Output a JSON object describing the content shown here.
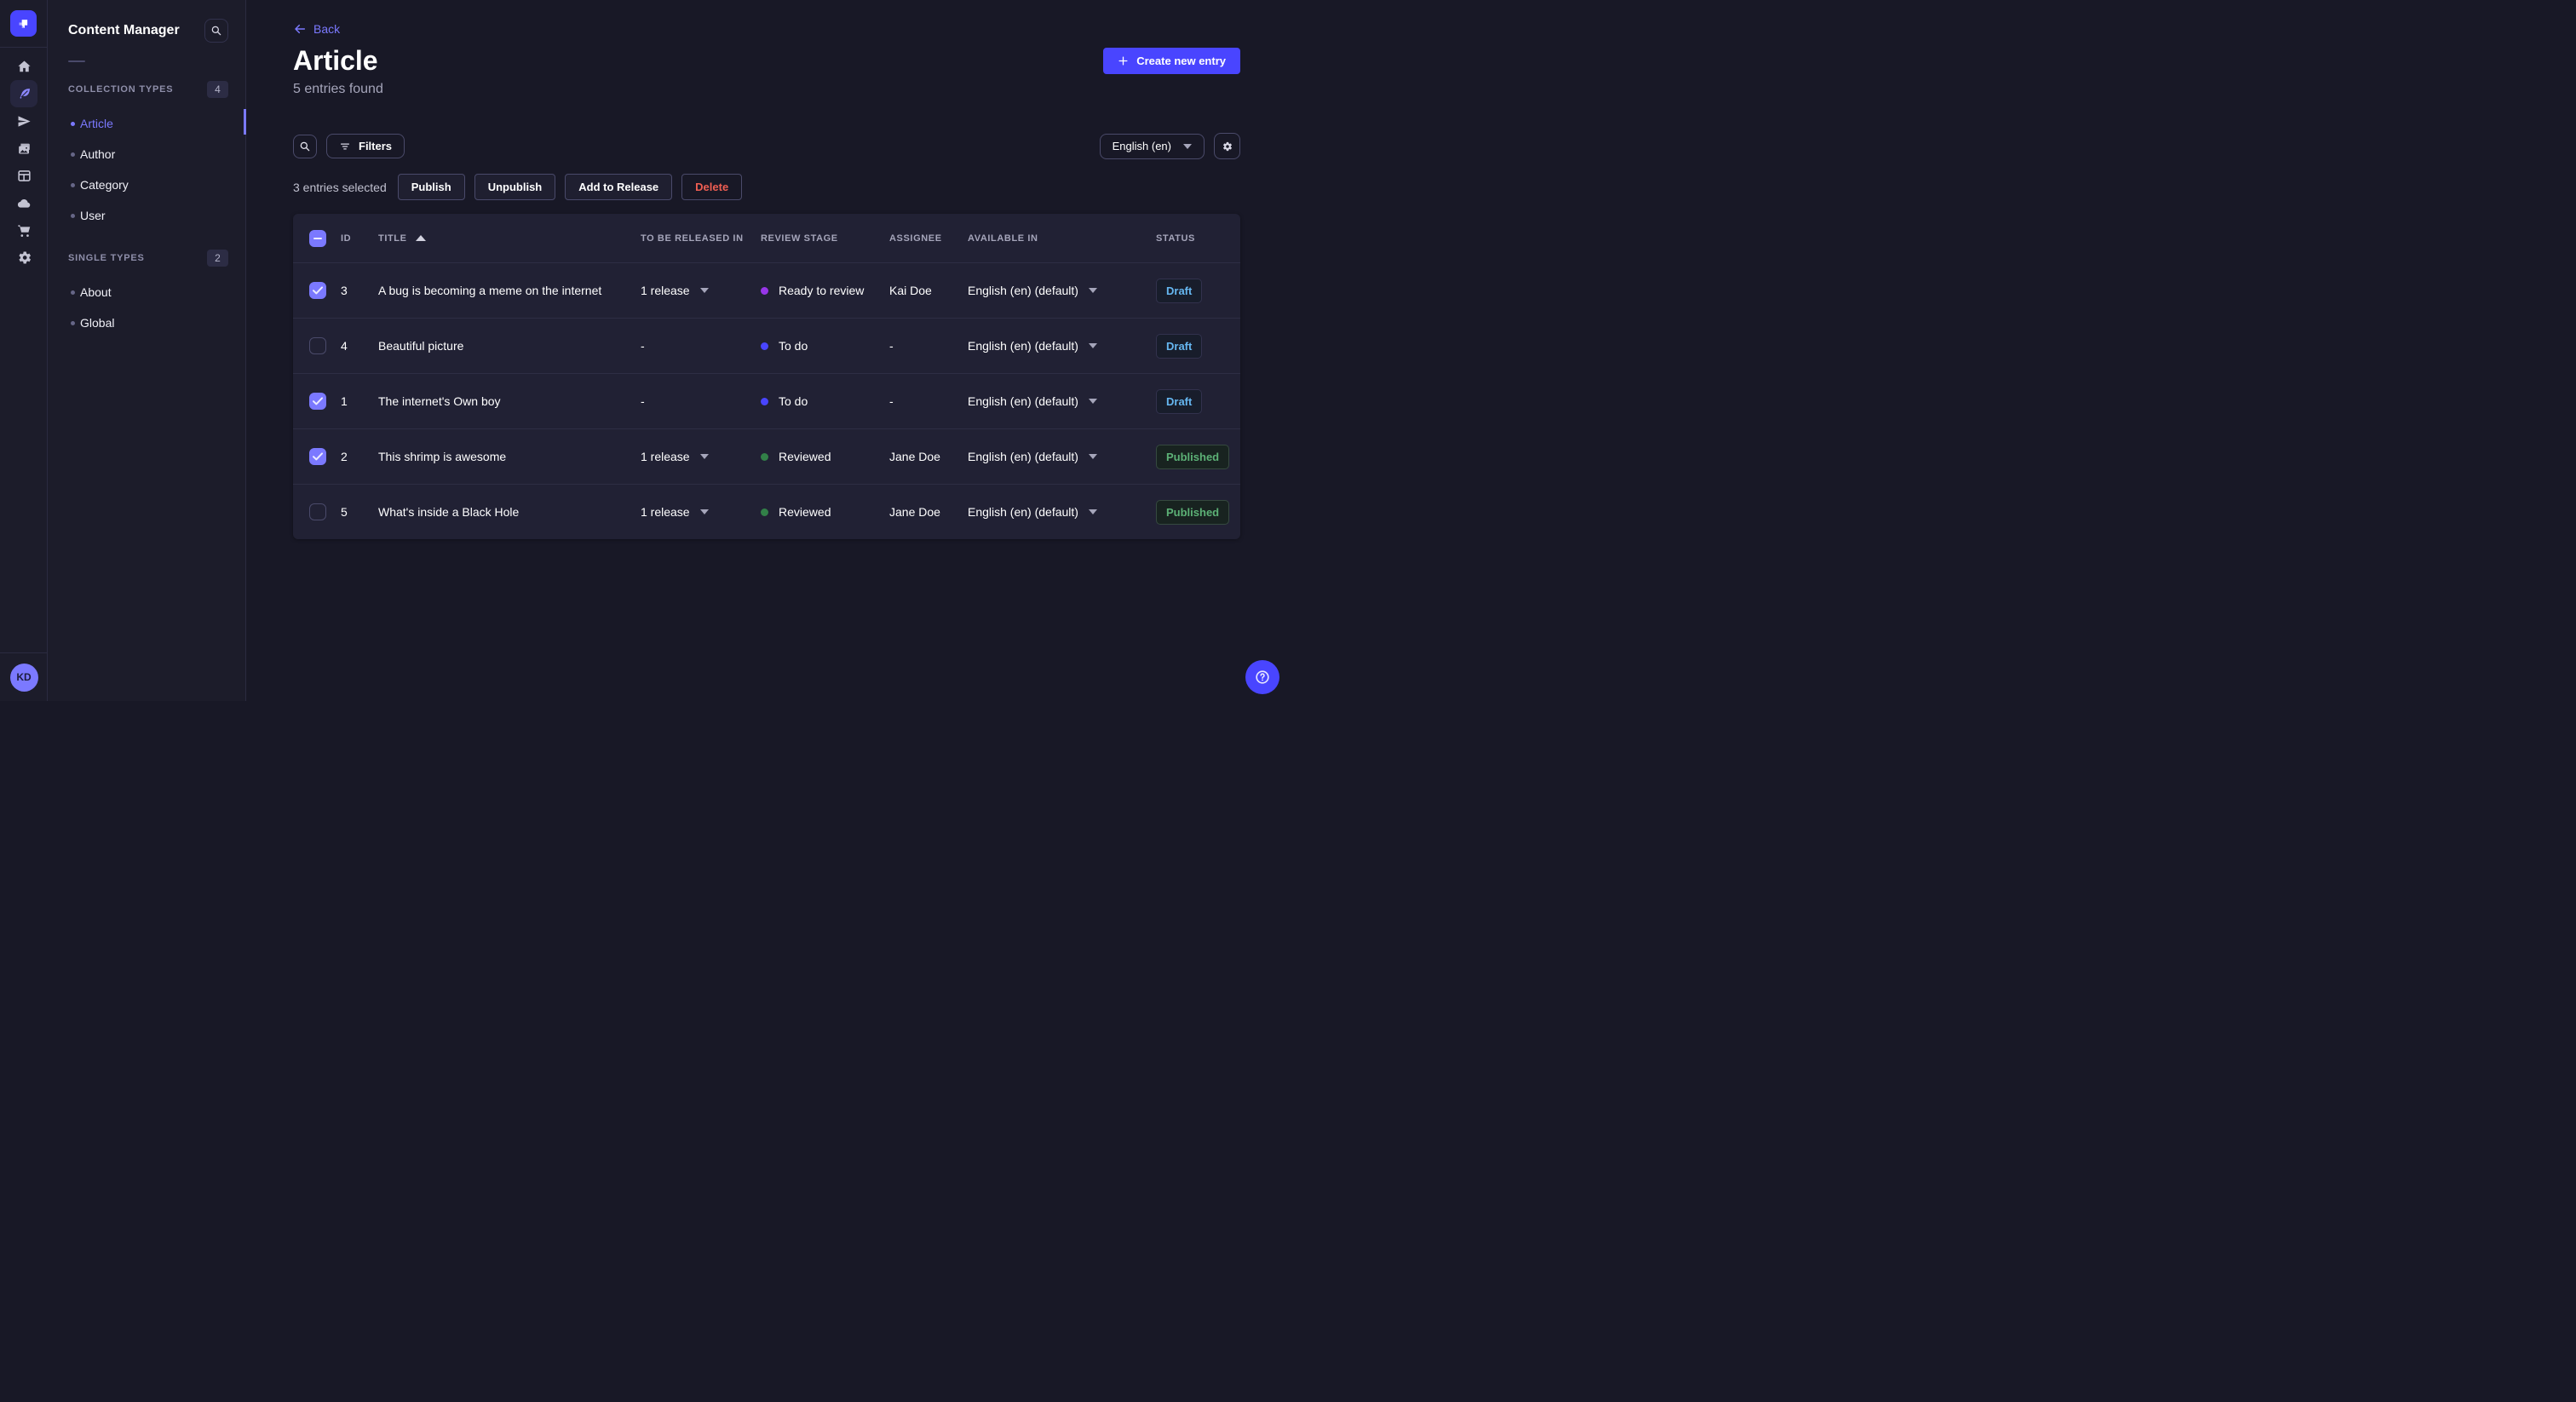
{
  "rail": {
    "items": [
      {
        "icon": "home",
        "name": "home",
        "active": false
      },
      {
        "icon": "feather",
        "name": "content-manager",
        "active": true
      },
      {
        "icon": "plane",
        "name": "releases",
        "active": false
      },
      {
        "icon": "images",
        "name": "media-library",
        "active": false
      },
      {
        "icon": "layout",
        "name": "content-type-builder",
        "active": false
      },
      {
        "icon": "cloud",
        "name": "deploy",
        "active": false
      },
      {
        "icon": "cart",
        "name": "marketplace",
        "active": false
      },
      {
        "icon": "gear",
        "name": "settings",
        "active": false
      }
    ],
    "avatar_initials": "KD"
  },
  "sidebar": {
    "title": "Content Manager",
    "sections": [
      {
        "label": "COLLECTION TYPES",
        "count": "4",
        "items": [
          {
            "label": "Article",
            "active": true
          },
          {
            "label": "Author",
            "active": false
          },
          {
            "label": "Category",
            "active": false
          },
          {
            "label": "User",
            "active": false
          }
        ]
      },
      {
        "label": "SINGLE TYPES",
        "count": "2",
        "items": [
          {
            "label": "About",
            "active": false
          },
          {
            "label": "Global",
            "active": false
          }
        ]
      }
    ]
  },
  "header": {
    "back_label": "Back",
    "title": "Article",
    "subtitle": "5 entries found",
    "create_label": "Create new entry"
  },
  "toolbar": {
    "filters_label": "Filters",
    "locale_value": "English (en)"
  },
  "selection": {
    "text": "3 entries selected",
    "publish_label": "Publish",
    "unpublish_label": "Unpublish",
    "release_label": "Add to Release",
    "delete_label": "Delete"
  },
  "table": {
    "headers": {
      "id": "ID",
      "title": "TITLE",
      "released": "TO BE RELEASED IN",
      "stage": "REVIEW STAGE",
      "assignee": "ASSIGNEE",
      "available": "AVAILABLE IN",
      "status": "STATUS"
    },
    "rows": [
      {
        "checked": true,
        "id": "3",
        "title": "A bug is becoming a meme on the internet",
        "released": "1 release",
        "has_release": true,
        "stage": "Ready to review",
        "stage_color": "#9736e8",
        "assignee": "Kai Doe",
        "available": "English (en) (default)",
        "status": "Draft",
        "status_type": "draft"
      },
      {
        "checked": false,
        "id": "4",
        "title": "Beautiful picture",
        "released": "-",
        "has_release": false,
        "stage": "To do",
        "stage_color": "#4945ff",
        "assignee": "-",
        "available": "English (en) (default)",
        "status": "Draft",
        "status_type": "draft"
      },
      {
        "checked": true,
        "id": "1",
        "title": "The internet's Own boy",
        "released": "-",
        "has_release": false,
        "stage": "To do",
        "stage_color": "#4945ff",
        "assignee": "-",
        "available": "English (en) (default)",
        "status": "Draft",
        "status_type": "draft"
      },
      {
        "checked": true,
        "id": "2",
        "title": "This shrimp is awesome",
        "released": "1 release",
        "has_release": true,
        "stage": "Reviewed",
        "stage_color": "#328048",
        "assignee": "Jane Doe",
        "available": "English (en) (default)",
        "status": "Published",
        "status_type": "published"
      },
      {
        "checked": false,
        "id": "5",
        "title": "What's inside a Black Hole",
        "released": "1 release",
        "has_release": true,
        "stage": "Reviewed",
        "stage_color": "#328048",
        "assignee": "Jane Doe",
        "available": "English (en) (default)",
        "status": "Published",
        "status_type": "published"
      }
    ]
  },
  "colors": {
    "accent": "#4945ff",
    "accent_light": "#7b79ff",
    "draft_text": "#66b7f1",
    "published_text": "#5cb176"
  }
}
